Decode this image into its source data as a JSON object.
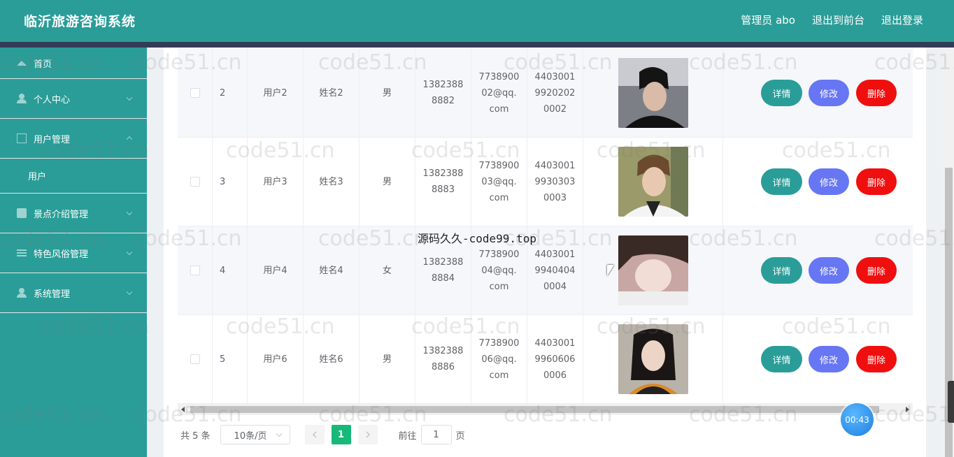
{
  "header": {
    "app_title": "临沂旅游咨询系统",
    "admin_label": "管理员 abo",
    "back_to_front": "退出到前台",
    "logout": "退出登录"
  },
  "sidebar": {
    "items": [
      {
        "label": "首页",
        "icon": "home-icon"
      },
      {
        "label": "个人中心",
        "icon": "user-icon"
      },
      {
        "label": "用户管理",
        "icon": "frame-icon",
        "expanded": true
      },
      {
        "label": "用户",
        "sub": true
      },
      {
        "label": "景点介绍管理",
        "icon": "thumb-icon"
      },
      {
        "label": "特色风俗管理",
        "icon": "list-icon"
      },
      {
        "label": "系统管理",
        "icon": "user-icon"
      }
    ]
  },
  "table": {
    "rows": [
      {
        "no": "2",
        "username": "用户2",
        "name": "姓名2",
        "gender": "男",
        "phone": [
          "1382388",
          "8882"
        ],
        "email": [
          "7738900",
          "02@qq.",
          "com"
        ],
        "idcard": [
          "4403001",
          "9920202",
          "0002"
        ]
      },
      {
        "no": "3",
        "username": "用户3",
        "name": "姓名3",
        "gender": "男",
        "phone": [
          "1382388",
          "8883"
        ],
        "email": [
          "7738900",
          "03@qq.",
          "com"
        ],
        "idcard": [
          "4403001",
          "9930303",
          "0003"
        ]
      },
      {
        "no": "4",
        "username": "用户4",
        "name": "姓名4",
        "gender": "女",
        "phone": [
          "1382388",
          "8884"
        ],
        "email": [
          "7738900",
          "04@qq.",
          "com"
        ],
        "idcard": [
          "4403001",
          "9940404",
          "0004"
        ]
      },
      {
        "no": "5",
        "username": "用户6",
        "name": "姓名6",
        "gender": "男",
        "phone": [
          "1382388",
          "8886"
        ],
        "email": [
          "7738900",
          "06@qq.",
          "com"
        ],
        "idcard": [
          "4403001",
          "9960606",
          "0006"
        ]
      }
    ],
    "actions": {
      "detail": "详情",
      "edit": "修改",
      "delete": "删除"
    }
  },
  "pagination": {
    "total": "共 5 条",
    "page_size": "10条/页",
    "current_page": "1",
    "goto_label": "前往",
    "goto_value": "1",
    "page_suffix": "页"
  },
  "overlay": {
    "timer": "00:43",
    "source_text": "源码久久-code99.top",
    "watermark": "code51.cn"
  },
  "colors": {
    "primary": "#2a9d98",
    "edit": "#6776f3",
    "delete": "#f00f0f",
    "page_active": "#17b978"
  }
}
